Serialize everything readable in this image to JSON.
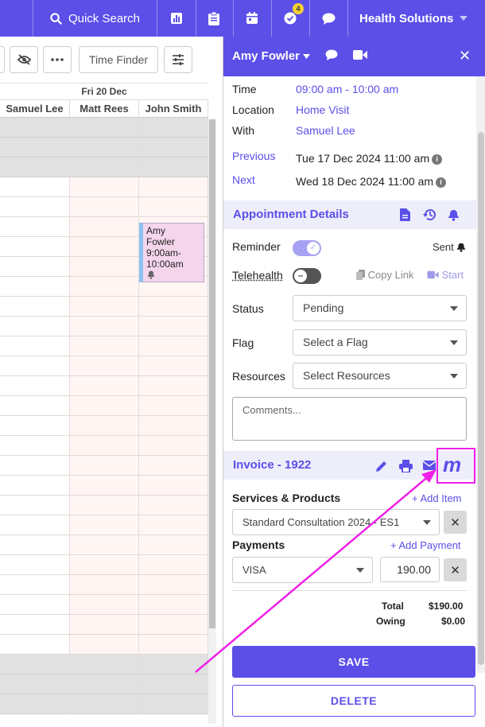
{
  "topnav": {
    "quick_search": "Quick Search",
    "badge_count": "4",
    "org_name": "Health Solutions",
    "icons": [
      "search-icon",
      "chart-icon",
      "clipboard-icon",
      "calendar-icon",
      "check-circle-icon",
      "chat-icon",
      "chevron-down-icon"
    ]
  },
  "calendar": {
    "toolbar": {
      "time_finder": "Time Finder"
    },
    "day": "Fri 20 Dec",
    "columns": [
      "Samuel Lee",
      "Matt Rees",
      "John Smith"
    ],
    "appointment": {
      "line1": "Amy",
      "line2": "Fowler",
      "line3": "9:00am-",
      "line4": "10:00am"
    }
  },
  "panel": {
    "patient_name": "Amy Fowler",
    "details": {
      "time_label": "Time",
      "time_value": "09:00 am - 10:00 am",
      "location_label": "Location",
      "location_value": "Home Visit",
      "with_label": "With",
      "with_value": "Samuel Lee",
      "previous_label": "Previous",
      "previous_value": "Tue 17 Dec 2024 11:00 am",
      "next_label": "Next",
      "next_value": "Wed 18 Dec 2024 11:00 am"
    },
    "appointment_details": {
      "title": "Appointment Details",
      "reminder_label": "Reminder",
      "reminder_status": "Sent",
      "telehealth_label": "Telehealth",
      "copy_link": "Copy Link",
      "start": "Start",
      "status_label": "Status",
      "status_value": "Pending",
      "flag_label": "Flag",
      "flag_value": "Select a Flag",
      "resources_label": "Resources",
      "resources_value": "Select Resources",
      "comments_placeholder": "Comments..."
    },
    "invoice": {
      "title": "Invoice - 1922",
      "services_label": "Services & Products",
      "add_item": "+ Add Item",
      "service_value": "Standard Consultation 2024 - ES1",
      "payments_label": "Payments",
      "add_payment": "+ Add Payment",
      "payment_method": "VISA",
      "payment_amount": "190.00",
      "total_label": "Total",
      "total_value": "$190.00",
      "owing_label": "Owing",
      "owing_value": "$0.00",
      "m_icon": "m"
    },
    "save": "SAVE",
    "delete": "DELETE"
  },
  "colors": {
    "brand": "#5b4fe8",
    "highlight": "#f020e8",
    "appointment_bg": "#f5d5ec",
    "closed_bg": "#e1e1e1"
  }
}
